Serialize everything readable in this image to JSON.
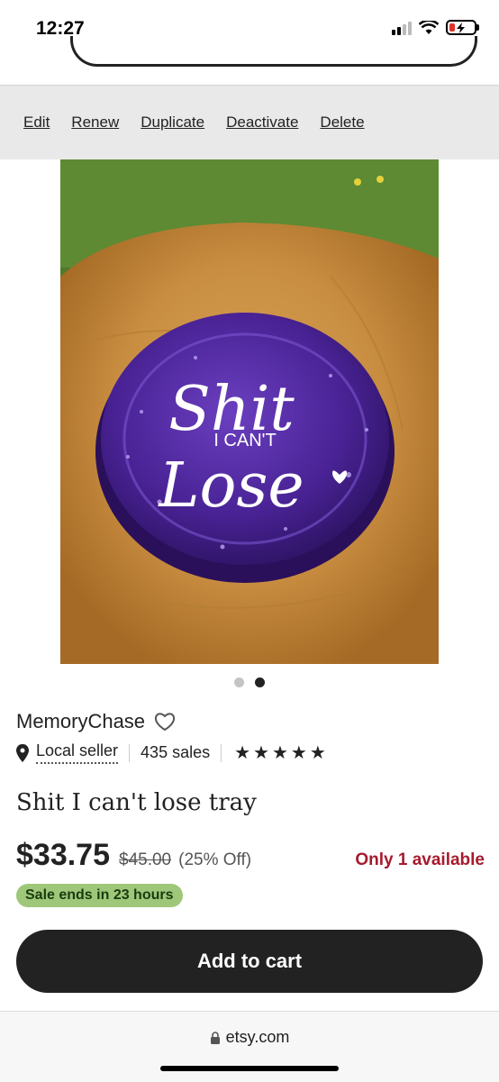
{
  "status": {
    "time": "12:27"
  },
  "toolbar": {
    "edit": "Edit",
    "renew": "Renew",
    "duplicate": "Duplicate",
    "deactivate": "Deactivate",
    "delete": "Delete"
  },
  "product_image": {
    "line1": "Shit",
    "line2": "I CAN'T",
    "line3": "Lose"
  },
  "gallery": {
    "current_slide": 2,
    "total_slides": 2
  },
  "shop": {
    "name": "MemoryChase",
    "local_label": "Local seller",
    "sales": "435 sales",
    "rating": 5
  },
  "listing": {
    "title": "Shit I can't lose tray",
    "price": "$33.75",
    "original_price": "$45.00",
    "discount": "(25% Off)",
    "availability": "Only 1 available",
    "sale_badge": "Sale ends in 23 hours",
    "cart_label": "Add to cart"
  },
  "browser": {
    "url": "etsy.com"
  },
  "colors": {
    "sale_badge_bg": "#9ec77a",
    "availability": "#a61a2e",
    "button_bg": "#222222"
  }
}
